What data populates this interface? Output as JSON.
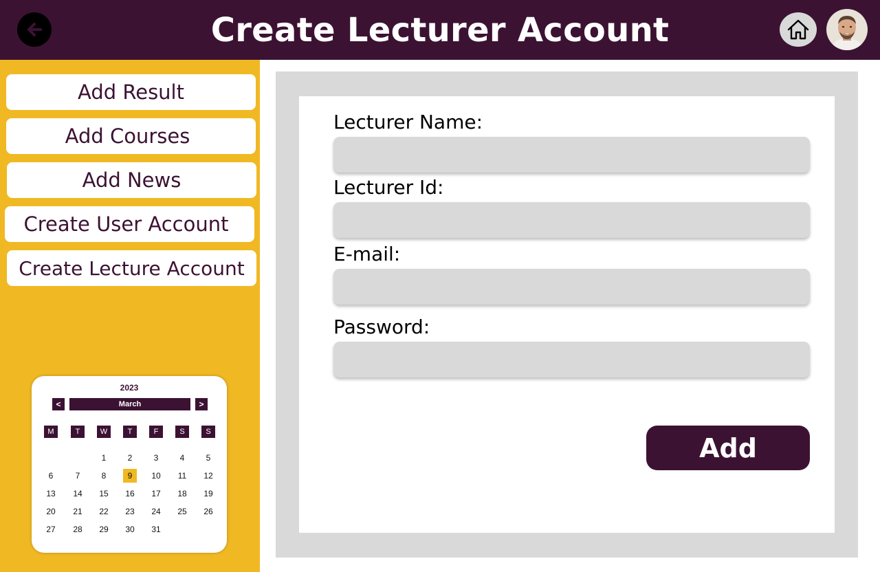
{
  "header": {
    "title": "Create Lecturer Account",
    "back_icon": "arrow-left-icon",
    "home_icon": "home-icon",
    "avatar_icon": "user-avatar"
  },
  "sidebar": {
    "items": [
      {
        "label": "Add Result"
      },
      {
        "label": "Add Courses"
      },
      {
        "label": "Add News"
      },
      {
        "label": "Create User Account"
      },
      {
        "label": "Create Lecture Account"
      }
    ]
  },
  "calendar": {
    "year": "2023",
    "month": "March",
    "prev_label": "<",
    "next_label": ">",
    "weekdays": [
      "M",
      "T",
      "W",
      "T",
      "F",
      "S",
      "S"
    ],
    "weeks": [
      [
        "",
        "",
        "1",
        "2",
        "3",
        "4",
        "5"
      ],
      [
        "6",
        "7",
        "8",
        "9",
        "10",
        "11",
        "12"
      ],
      [
        "13",
        "14",
        "15",
        "16",
        "17",
        "18",
        "19"
      ],
      [
        "20",
        "21",
        "22",
        "23",
        "24",
        "25",
        "26"
      ],
      [
        "27",
        "28",
        "29",
        "30",
        "31",
        "",
        ""
      ]
    ],
    "selected_day": "9"
  },
  "form": {
    "fields": [
      {
        "label": "Lecturer Name:",
        "value": "",
        "placeholder": ""
      },
      {
        "label": "Lecturer Id:",
        "value": "",
        "placeholder": ""
      },
      {
        "label": "E-mail:",
        "value": "",
        "placeholder": ""
      },
      {
        "label": "Password:",
        "value": "",
        "placeholder": ""
      }
    ],
    "submit_label": "Add"
  },
  "colors": {
    "primary": "#3c1233",
    "accent": "#f0b823",
    "panel": "#d9d9d9",
    "white": "#ffffff"
  }
}
